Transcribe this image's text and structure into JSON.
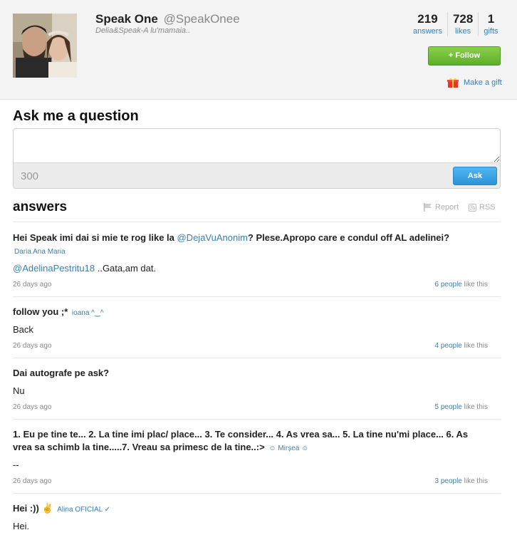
{
  "profile": {
    "name": "Speak One",
    "handle": "@SpeakOnee",
    "bio": "Delia&Speak-A lu'mamaia.."
  },
  "stats": [
    {
      "value": "219",
      "label": "answers"
    },
    {
      "value": "728",
      "label": "likes"
    },
    {
      "value": "1",
      "label": "gifts"
    }
  ],
  "follow_label": "+ Follow",
  "gift_label": "Make a gift",
  "ask": {
    "title": "Ask me a question",
    "placeholder": "",
    "counter": "300",
    "button_label": "Ask"
  },
  "answers_section": {
    "title": "answers",
    "report_label": "Report",
    "rss_label": "RSS"
  },
  "answers": [
    {
      "question_prefix": "Hei Speak imi dai si mie te rog like la ",
      "question_mention": "@DejaVuAnonim",
      "question_suffix": "? Plese.Apropo care e condul off AL adelinei?",
      "author": "Daria Ana Maria",
      "answer_mention": "@AdelinaPestritu18",
      "answer_text": " ..Gata,am dat.",
      "time": "26 days ago",
      "likes_count": "6 people",
      "likes_suffix": " like this"
    },
    {
      "question": "follow you ;*",
      "author": "ioana ^‿^",
      "answer_text": "Back",
      "time": "26 days ago",
      "likes_count": "4 people",
      "likes_suffix": " like this"
    },
    {
      "question": "Dai autografe pe ask?",
      "author": "",
      "answer_text": "Nu",
      "time": "26 days ago",
      "likes_count": "5 people",
      "likes_suffix": " like this"
    },
    {
      "question": "1. Eu pe tine te... 2. La tine imi plac/ place... 3. Te consider... 4. As vrea sa... 5. La tine nu'mi place... 6. As vrea sa schimb la tine.....7. Vreau sa primesc de la tine..:>",
      "author": "☺ Mirșea ☺",
      "answer_text": "--",
      "time": "26 days ago",
      "likes_count": "3 people",
      "likes_suffix": " like this"
    },
    {
      "question": "Hei :)) ✌",
      "author": "Alina OFICIAL ✓",
      "answer_text": "Hei.",
      "time": "",
      "likes_count": "",
      "likes_suffix": ""
    }
  ],
  "colors": {
    "link": "#3a7fb0",
    "follow_green": "#6cbf35",
    "ask_blue": "#2b95d8",
    "header_bg": "#f3f3f3"
  }
}
